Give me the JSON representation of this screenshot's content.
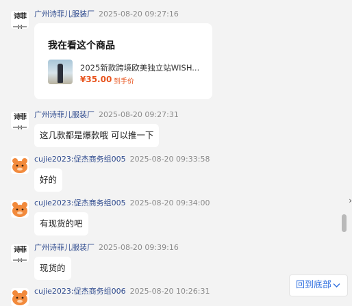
{
  "messages": [
    {
      "sender": "广州诗菲儿服装厂",
      "time": "2025-08-20 09:27:16",
      "type": "product_card"
    },
    {
      "sender": "广州诗菲儿服装厂",
      "time": "2025-08-20 09:27:31",
      "text": "这几款都是爆款哦 可以推一下"
    },
    {
      "sender": "cujie2023:促杰商务组005",
      "time": "2025-08-20 09:33:58",
      "text": "好的"
    },
    {
      "sender": "cujie2023:促杰商务组005",
      "time": "2025-08-20 09:34:00",
      "text": "有现货的吧"
    },
    {
      "sender": "广州诗菲儿服装厂",
      "time": "2025-08-20 09:39:16",
      "text": "现货的"
    },
    {
      "sender": "cujie2023:促杰商务组006",
      "time": "2025-08-20 10:26:31"
    }
  ],
  "product_card": {
    "title": "我在看这个商品",
    "description": "2025新款跨境欧美独立站WISH...",
    "price": "¥35.00",
    "price_note": "到手价"
  },
  "shop_avatar_text": "诗菲儿",
  "scroll_arrow": "›",
  "back_to_bottom_label": "回到底部",
  "colors": {
    "sender_name": "#2e4a8e",
    "price": "#e8541e",
    "link": "#2f6fdf",
    "avatar_orange": "#f28a3c"
  }
}
